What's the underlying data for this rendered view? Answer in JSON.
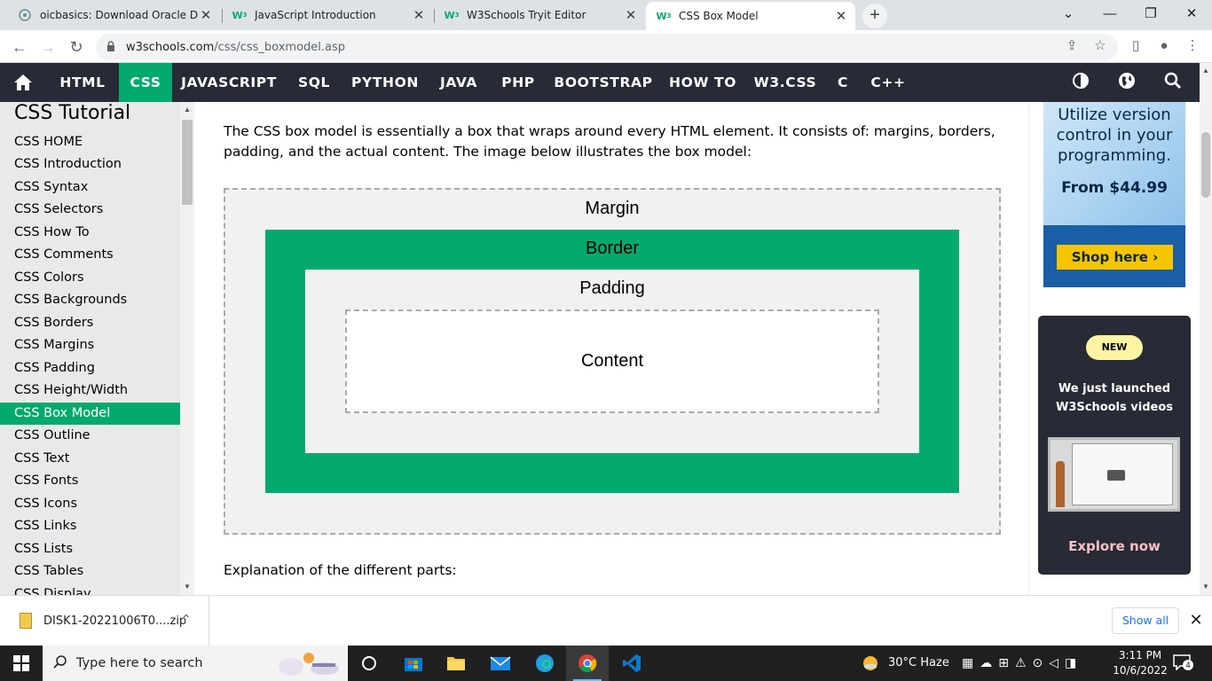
{
  "browser": {
    "tabs": [
      {
        "title": "oicbasics: Download Oracle Data",
        "favicon": "blog-favicon"
      },
      {
        "title": "JavaScript Introduction",
        "favicon": "w3schools-favicon"
      },
      {
        "title": "W3Schools Tryit Editor",
        "favicon": "w3schools-favicon"
      },
      {
        "title": "CSS Box Model",
        "favicon": "w3schools-favicon",
        "active": true
      }
    ],
    "url_host": "w3schools.com",
    "url_path": "/css/css_boxmodel.asp"
  },
  "topnav": {
    "items": [
      "HTML",
      "CSS",
      "JAVASCRIPT",
      "SQL",
      "PYTHON",
      "JAVA",
      "PHP",
      "BOOTSTRAP",
      "HOW TO",
      "W3.CSS",
      "C",
      "C++"
    ],
    "active": "CSS"
  },
  "sidebar": {
    "title": "CSS Tutorial",
    "items": [
      "CSS HOME",
      "CSS Introduction",
      "CSS Syntax",
      "CSS Selectors",
      "CSS How To",
      "CSS Comments",
      "CSS Colors",
      "CSS Backgrounds",
      "CSS Borders",
      "CSS Margins",
      "CSS Padding",
      "CSS Height/Width",
      "CSS Box Model",
      "CSS Outline",
      "CSS Text",
      "CSS Fonts",
      "CSS Icons",
      "CSS Links",
      "CSS Lists",
      "CSS Tables",
      "CSS Display"
    ],
    "active": "CSS Box Model"
  },
  "main": {
    "intro": "The CSS box model is essentially a box that wraps around every HTML element. It consists of: margins, borders, padding, and the actual content. The image below illustrates the box model:",
    "diagram": {
      "margin": "Margin",
      "border": "Border",
      "padding": "Padding",
      "content": "Content"
    },
    "explanation": "Explanation of the different parts:"
  },
  "ads": {
    "ad1_text": "Utilize version control in your programming.",
    "ad1_price": "From $44.99",
    "ad1_button": "Shop here ›",
    "ad2_badge": "NEW",
    "ad2_heading": "We just launched W3Schools videos",
    "ad2_link": "Explore now"
  },
  "downloads": {
    "file": "DISK1-20221006T0....zip",
    "show_all": "Show all"
  },
  "taskbar": {
    "search_placeholder": "Type here to search",
    "weather": "30°C  Haze",
    "time": "3:11 PM",
    "date": "10/6/2022",
    "notifications": "4"
  },
  "colors": {
    "w3_green": "#04aa6d",
    "w3_dark": "#282a35",
    "ad_yellow": "#f6c500"
  }
}
